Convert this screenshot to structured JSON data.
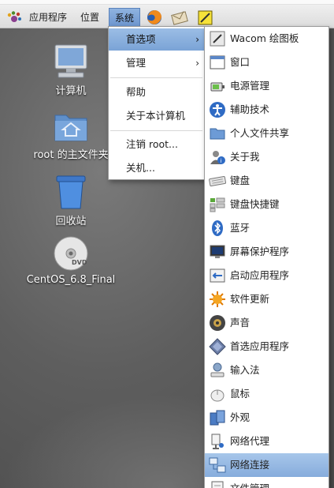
{
  "panel": {
    "applications_label": "应用程序",
    "places_label": "位置",
    "system_label": "系统"
  },
  "desktop": {
    "computer_label": "计算机",
    "home_label": "root 的主文件夹",
    "trash_label": "回收站",
    "dvd_label": "CentOS_6.8_Final",
    "dvd_badge": "DVD"
  },
  "system_menu": {
    "items": [
      {
        "label": "首选项",
        "has_submenu": true
      },
      {
        "label": "管理",
        "has_submenu": true
      },
      {
        "label": "帮助"
      },
      {
        "label": "关于本计算机"
      },
      {
        "label": "注销 root..."
      },
      {
        "label": "关机..."
      }
    ],
    "submenu_arrow": "›"
  },
  "preferences_menu": {
    "items": [
      {
        "label": "Wacom 绘图板",
        "icon": "wacom-tablet-icon"
      },
      {
        "label": "窗口",
        "icon": "window-icon"
      },
      {
        "label": "电源管理",
        "icon": "power-icon"
      },
      {
        "label": "辅助技术",
        "icon": "accessibility-icon"
      },
      {
        "label": "个人文件共享",
        "icon": "folder-share-icon"
      },
      {
        "label": "关于我",
        "icon": "about-me-icon"
      },
      {
        "label": "键盘",
        "icon": "keyboard-icon"
      },
      {
        "label": "键盘快捷键",
        "icon": "keyboard-shortcuts-icon"
      },
      {
        "label": "蓝牙",
        "icon": "bluetooth-icon"
      },
      {
        "label": "屏幕保护程序",
        "icon": "screensaver-icon"
      },
      {
        "label": "启动应用程序",
        "icon": "startup-apps-icon"
      },
      {
        "label": "软件更新",
        "icon": "software-update-icon"
      },
      {
        "label": "声音",
        "icon": "sound-icon"
      },
      {
        "label": "首选应用程序",
        "icon": "preferred-apps-icon"
      },
      {
        "label": "输入法",
        "icon": "input-method-icon"
      },
      {
        "label": "鼠标",
        "icon": "mouse-icon"
      },
      {
        "label": "外观",
        "icon": "appearance-icon"
      },
      {
        "label": "网络代理",
        "icon": "network-proxy-icon"
      },
      {
        "label": "网络连接",
        "icon": "network-connections-icon",
        "highlighted": true
      },
      {
        "label": "文件管理",
        "icon": "file-management-icon"
      }
    ]
  },
  "colors": {
    "highlight": "#86acdc",
    "panel_bg": "#dcdcdc"
  }
}
